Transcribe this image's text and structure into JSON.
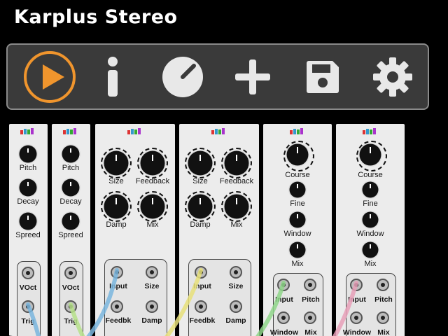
{
  "window": {
    "title": "Karplus Stereo"
  },
  "toolbar": {
    "buttons": [
      {
        "name": "play",
        "icon": "play-icon"
      },
      {
        "name": "info",
        "icon": "info-icon"
      },
      {
        "name": "knob",
        "icon": "knob-icon"
      },
      {
        "name": "add",
        "icon": "plus-icon"
      },
      {
        "name": "save",
        "icon": "floppy-disk-icon"
      },
      {
        "name": "settings",
        "icon": "gear-icon"
      }
    ],
    "accent": "#f0952d"
  },
  "modules": [
    {
      "id": "m1",
      "labels": {
        "pitch": "Pitch",
        "decay": "Decay",
        "spreed": "Spreed",
        "vout": "VOct",
        "trig": "Trig"
      }
    },
    {
      "id": "m2",
      "labels": {
        "pitch": "Pitch",
        "decay": "Decay",
        "spreed": "Spreed",
        "vout": "VOct",
        "trig": "Trig"
      }
    },
    {
      "id": "m3",
      "labels": {
        "size": "Size",
        "feedback": "Feedback",
        "damp": "Damp",
        "mix": "Mix",
        "input": "Input",
        "size_jack": "Size",
        "feedbk": "Feedbk",
        "damp_jack": "Damp"
      }
    },
    {
      "id": "m4",
      "labels": {
        "size": "Size",
        "feedback": "Feedback",
        "damp": "Damp",
        "mix": "Mix",
        "input": "Input",
        "size_jack": "Size",
        "feedbk": "Feedbk",
        "damp_jack": "Damp"
      }
    },
    {
      "id": "m5",
      "labels": {
        "course": "Course",
        "fine": "Fine",
        "window": "Window",
        "mix": "Mix",
        "input": "Input",
        "pitch": "Pitch",
        "window_jack": "Window",
        "mix_jack": "Mix"
      }
    },
    {
      "id": "m6",
      "labels": {
        "course": "Course",
        "fine": "Fine",
        "window": "Window",
        "mix": "Mix",
        "input": "Input",
        "pitch": "Pitch",
        "window_jack": "Window",
        "mix_jack": "Mix"
      }
    }
  ],
  "cables": {
    "colors": [
      "#7ab6de",
      "#b6e08a",
      "#e8e07a",
      "#8fd68a",
      "#e8a0b8"
    ]
  }
}
